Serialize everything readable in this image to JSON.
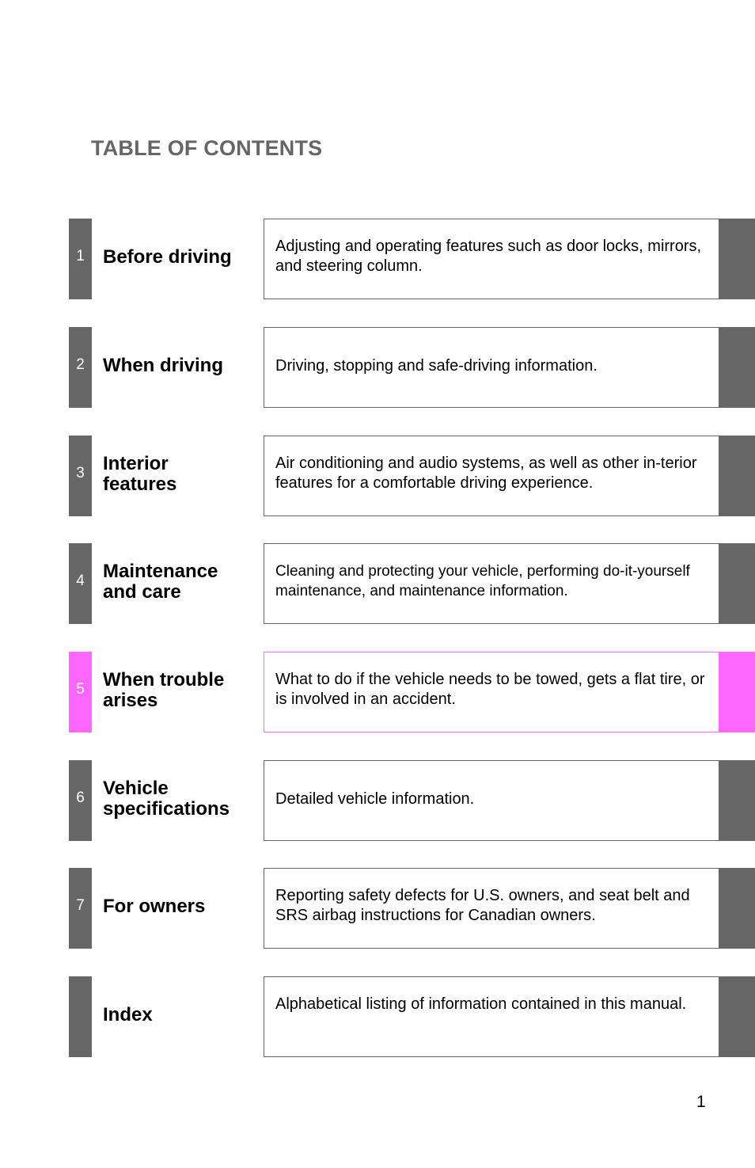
{
  "title": "TABLE OF CONTENTS",
  "accent_color": "#ff66ff",
  "tab_color": "#666666",
  "sections": [
    {
      "number": "1",
      "heading": "Before driving",
      "description": "Adjusting and operating features such as door locks, mirrors, and steering column.",
      "active": false
    },
    {
      "number": "2",
      "heading": "When driving",
      "description": "Driving, stopping and safe-driving information.",
      "active": false
    },
    {
      "number": "3",
      "heading": "Interior features",
      "description": "Air conditioning and audio systems, as well as other in-terior features for a comfortable driving experience.",
      "active": false
    },
    {
      "number": "4",
      "heading": "Maintenance and care",
      "description": "Cleaning and protecting your vehicle, performing do-it-yourself maintenance, and maintenance information.",
      "active": false
    },
    {
      "number": "5",
      "heading": "When trouble arises",
      "description": "What to do if the vehicle needs to be towed, gets a flat tire, or is involved in an accident.",
      "active": true
    },
    {
      "number": "6",
      "heading": "Vehicle specifications",
      "description": "Detailed vehicle information.",
      "active": false
    },
    {
      "number": "7",
      "heading": "For owners",
      "description": "Reporting safety defects for U.S. owners, and seat belt and SRS airbag instructions for Canadian owners.",
      "active": false
    },
    {
      "number": "",
      "heading": "Index",
      "description": "Alphabetical listing of information contained in this manual.",
      "active": false
    }
  ],
  "page_number": "1"
}
